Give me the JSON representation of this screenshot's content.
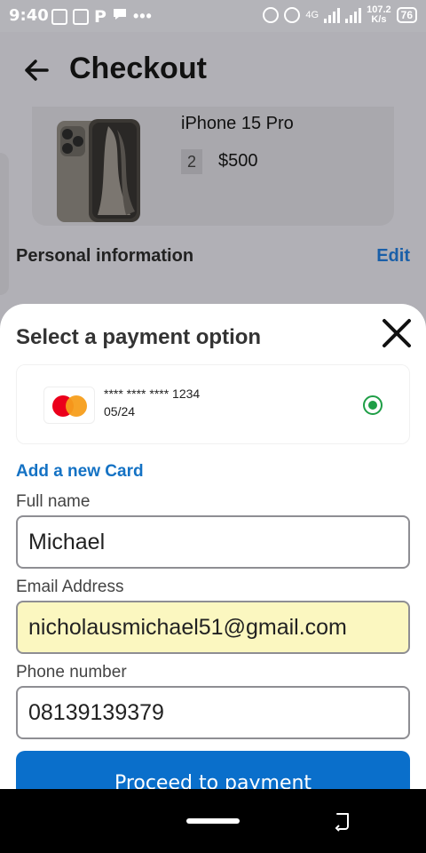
{
  "status_bar": {
    "time": "9:40",
    "network_type": "4G",
    "speed_value": "107.2",
    "speed_unit": "K/s",
    "battery": "76"
  },
  "header": {
    "title": "Checkout",
    "back_icon": "arrow-left-icon"
  },
  "product": {
    "name": "iPhone 15 Pro",
    "quantity": "2",
    "price": "$500"
  },
  "personal_info": {
    "title": "Personal information",
    "edit_label": "Edit"
  },
  "payment_sheet": {
    "title": "Select a payment option",
    "close_icon": "close-icon",
    "card": {
      "brand_icon": "mastercard-icon",
      "number": "**** **** **** 1234",
      "expiry": "05/24",
      "selected": true
    },
    "add_card_label": "Add a new Card",
    "fields": {
      "full_name": {
        "label": "Full name",
        "value": "Michael"
      },
      "email": {
        "label": "Email Address",
        "value": "nicholausmichael51@gmail.com"
      },
      "phone": {
        "label": "Phone number",
        "value": "08139139379"
      }
    },
    "proceed_label": "Proceed to payment"
  },
  "colors": {
    "primary": "#0a6fcb",
    "link": "#1472c4",
    "radio": "#1e9e46",
    "autofill": "#fbf7c0"
  }
}
